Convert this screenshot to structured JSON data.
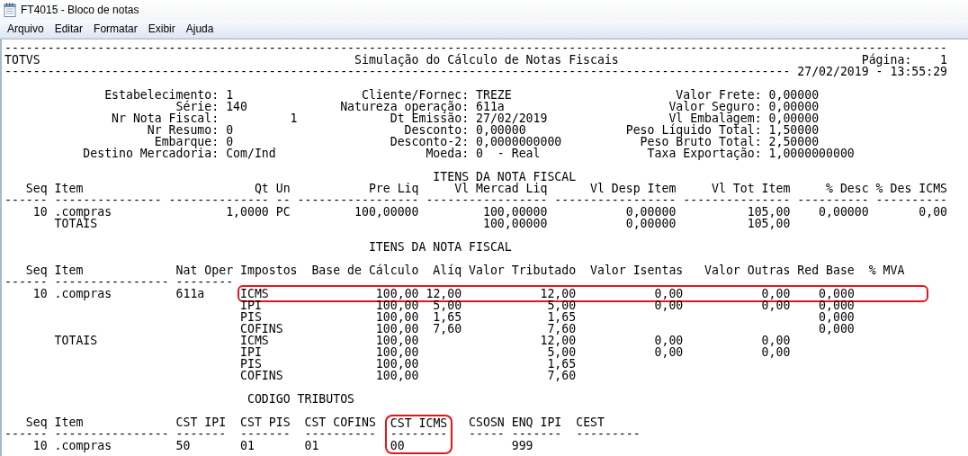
{
  "window": {
    "title": "FT4015 - Bloco de notas"
  },
  "menu": [
    {
      "label": "Arquivo"
    },
    {
      "label": "Editar"
    },
    {
      "label": "Formatar"
    },
    {
      "label": "Exibir"
    },
    {
      "label": "Ajuda"
    }
  ],
  "lines": [
    {
      "kind": "text",
      "segments": [
        {
          "text": "------------------------------------------------------------------------------------------------------------------------------------"
        }
      ]
    },
    {
      "kind": "text",
      "segments": [
        {
          "text": "TOTVS                                            Simulação do Cálculo de Notas Fiscais                                  Página:    1"
        }
      ]
    },
    {
      "kind": "text",
      "segments": [
        {
          "text": "-------------------------------------------------------------------------------------------------------------- 27/02/2019 - 13:55:29"
        }
      ]
    },
    {
      "kind": "blank"
    },
    {
      "kind": "text",
      "segments": [
        {
          "text": "              Estabelecimento: 1                  Cliente/Fornec: TREZE                       Valor Frete: 0,00000"
        }
      ]
    },
    {
      "kind": "text",
      "segments": [
        {
          "text": "                        Série: 140             Natureza operação: 611a                       Valor Seguro: 0,00000"
        }
      ]
    },
    {
      "kind": "text",
      "segments": [
        {
          "text": "               Nr Nota Fiscal:          1             Dt Emissão: 27/02/2019                 Vl Embalagem: 0,00000"
        }
      ]
    },
    {
      "kind": "text",
      "segments": [
        {
          "text": "                    Nr Resumo: 0                        Desconto: 0,00000              Peso Líquido Total: 1,50000"
        }
      ]
    },
    {
      "kind": "text",
      "segments": [
        {
          "text": "                     Embarque: 0                      Desconto-2: 0,0000000000           Peso Bruto Total: 2,50000"
        }
      ]
    },
    {
      "kind": "text",
      "segments": [
        {
          "text": "           Destino Mercadoria: Com/Ind                     Moeda: 0  - Real               Taxa Exportação: 1,0000000000"
        }
      ]
    },
    {
      "kind": "blank"
    },
    {
      "kind": "text",
      "segments": [
        {
          "text": "                                                            ITENS DA NOTA FISCAL"
        }
      ]
    },
    {
      "kind": "text",
      "segments": [
        {
          "text": "   Seq Item                        Qt Un           Pre Liq     Vl Mercad Liq      Vl Desp Item     Vl Tot Item     % Desc % Des ICMS"
        }
      ]
    },
    {
      "kind": "text",
      "segments": [
        {
          "text": "------ --------------- -------------- -- ----------------- ----------------- ----------------- --------------- ---------- ----------"
        }
      ]
    },
    {
      "kind": "text",
      "segments": [
        {
          "text": "    10 .compras                1,0000 PC         100,00000         100,00000           0,00000          105,00    0,00000       0,00"
        }
      ]
    },
    {
      "kind": "text",
      "segments": [
        {
          "text": "       TOTAIS                                                      100,00000           0,00000          105,00"
        }
      ]
    },
    {
      "kind": "blank"
    },
    {
      "kind": "text",
      "segments": [
        {
          "text": "                                                   ITENS DA NOTA FISCAL"
        }
      ]
    },
    {
      "kind": "blank"
    },
    {
      "kind": "text",
      "segments": [
        {
          "text": "   Seq Item             Nat Oper Impostos  Base de Cálculo  Alíq Valor Tributado  Valor Isentas   Valor Outras Red Base  % MVA"
        }
      ]
    },
    {
      "kind": "text",
      "segments": [
        {
          "text": "------ ---------------- --------"
        }
      ]
    },
    {
      "kind": "text",
      "segments": [
        {
          "text": "    10 .compras         611a     "
        },
        {
          "text": "ICMS               100,00 12,00           12,00           0,00           0,00    0,000          ",
          "circled": true,
          "joins_above": false,
          "joins_below": false
        }
      ]
    },
    {
      "kind": "text",
      "segments": [
        {
          "text": "                                 IPI                100,00  5,00            5,00           0,00           0,00    0,000"
        }
      ]
    },
    {
      "kind": "text",
      "segments": [
        {
          "text": "                                 PIS                100,00  1,65            1,65                                  0,000"
        }
      ]
    },
    {
      "kind": "text",
      "segments": [
        {
          "text": "                                 COFINS             100,00  7,60            7,60                                  0,000"
        }
      ]
    },
    {
      "kind": "text",
      "segments": [
        {
          "text": "       TOTAIS                    ICMS               100,00                 12,00           0,00           0,00"
        }
      ]
    },
    {
      "kind": "text",
      "segments": [
        {
          "text": "                                 IPI                100,00                  5,00           0,00           0,00"
        }
      ]
    },
    {
      "kind": "text",
      "segments": [
        {
          "text": "                                 PIS                100,00                  1,65"
        }
      ]
    },
    {
      "kind": "text",
      "segments": [
        {
          "text": "                                 COFINS             100,00                  7,60"
        }
      ]
    },
    {
      "kind": "blank"
    },
    {
      "kind": "text",
      "segments": [
        {
          "text": "                                  CODIGO TRIBUTOS"
        }
      ]
    },
    {
      "kind": "blank"
    },
    {
      "kind": "text",
      "segments": [
        {
          "text": "   Seq Item             CST IPI  CST PIS  CST COFINS  "
        },
        {
          "text": "CST ICMS",
          "circled": true,
          "joins_above": false,
          "joins_below": true
        },
        {
          "text": "   CSOSN ENQ IPI  CEST"
        }
      ]
    },
    {
      "kind": "text",
      "segments": [
        {
          "text": "------ ---------------- -------  -------  ----------  "
        },
        {
          "text": "--------",
          "circled": true,
          "joins_above": true,
          "joins_below": true
        },
        {
          "text": "   ----- -------  ---------"
        }
      ]
    },
    {
      "kind": "text",
      "segments": [
        {
          "text": "    10 .compras         50       01       01          "
        },
        {
          "text": "00      ",
          "circled": true,
          "joins_above": true,
          "joins_below": false
        },
        {
          "text": "         999"
        }
      ]
    }
  ]
}
